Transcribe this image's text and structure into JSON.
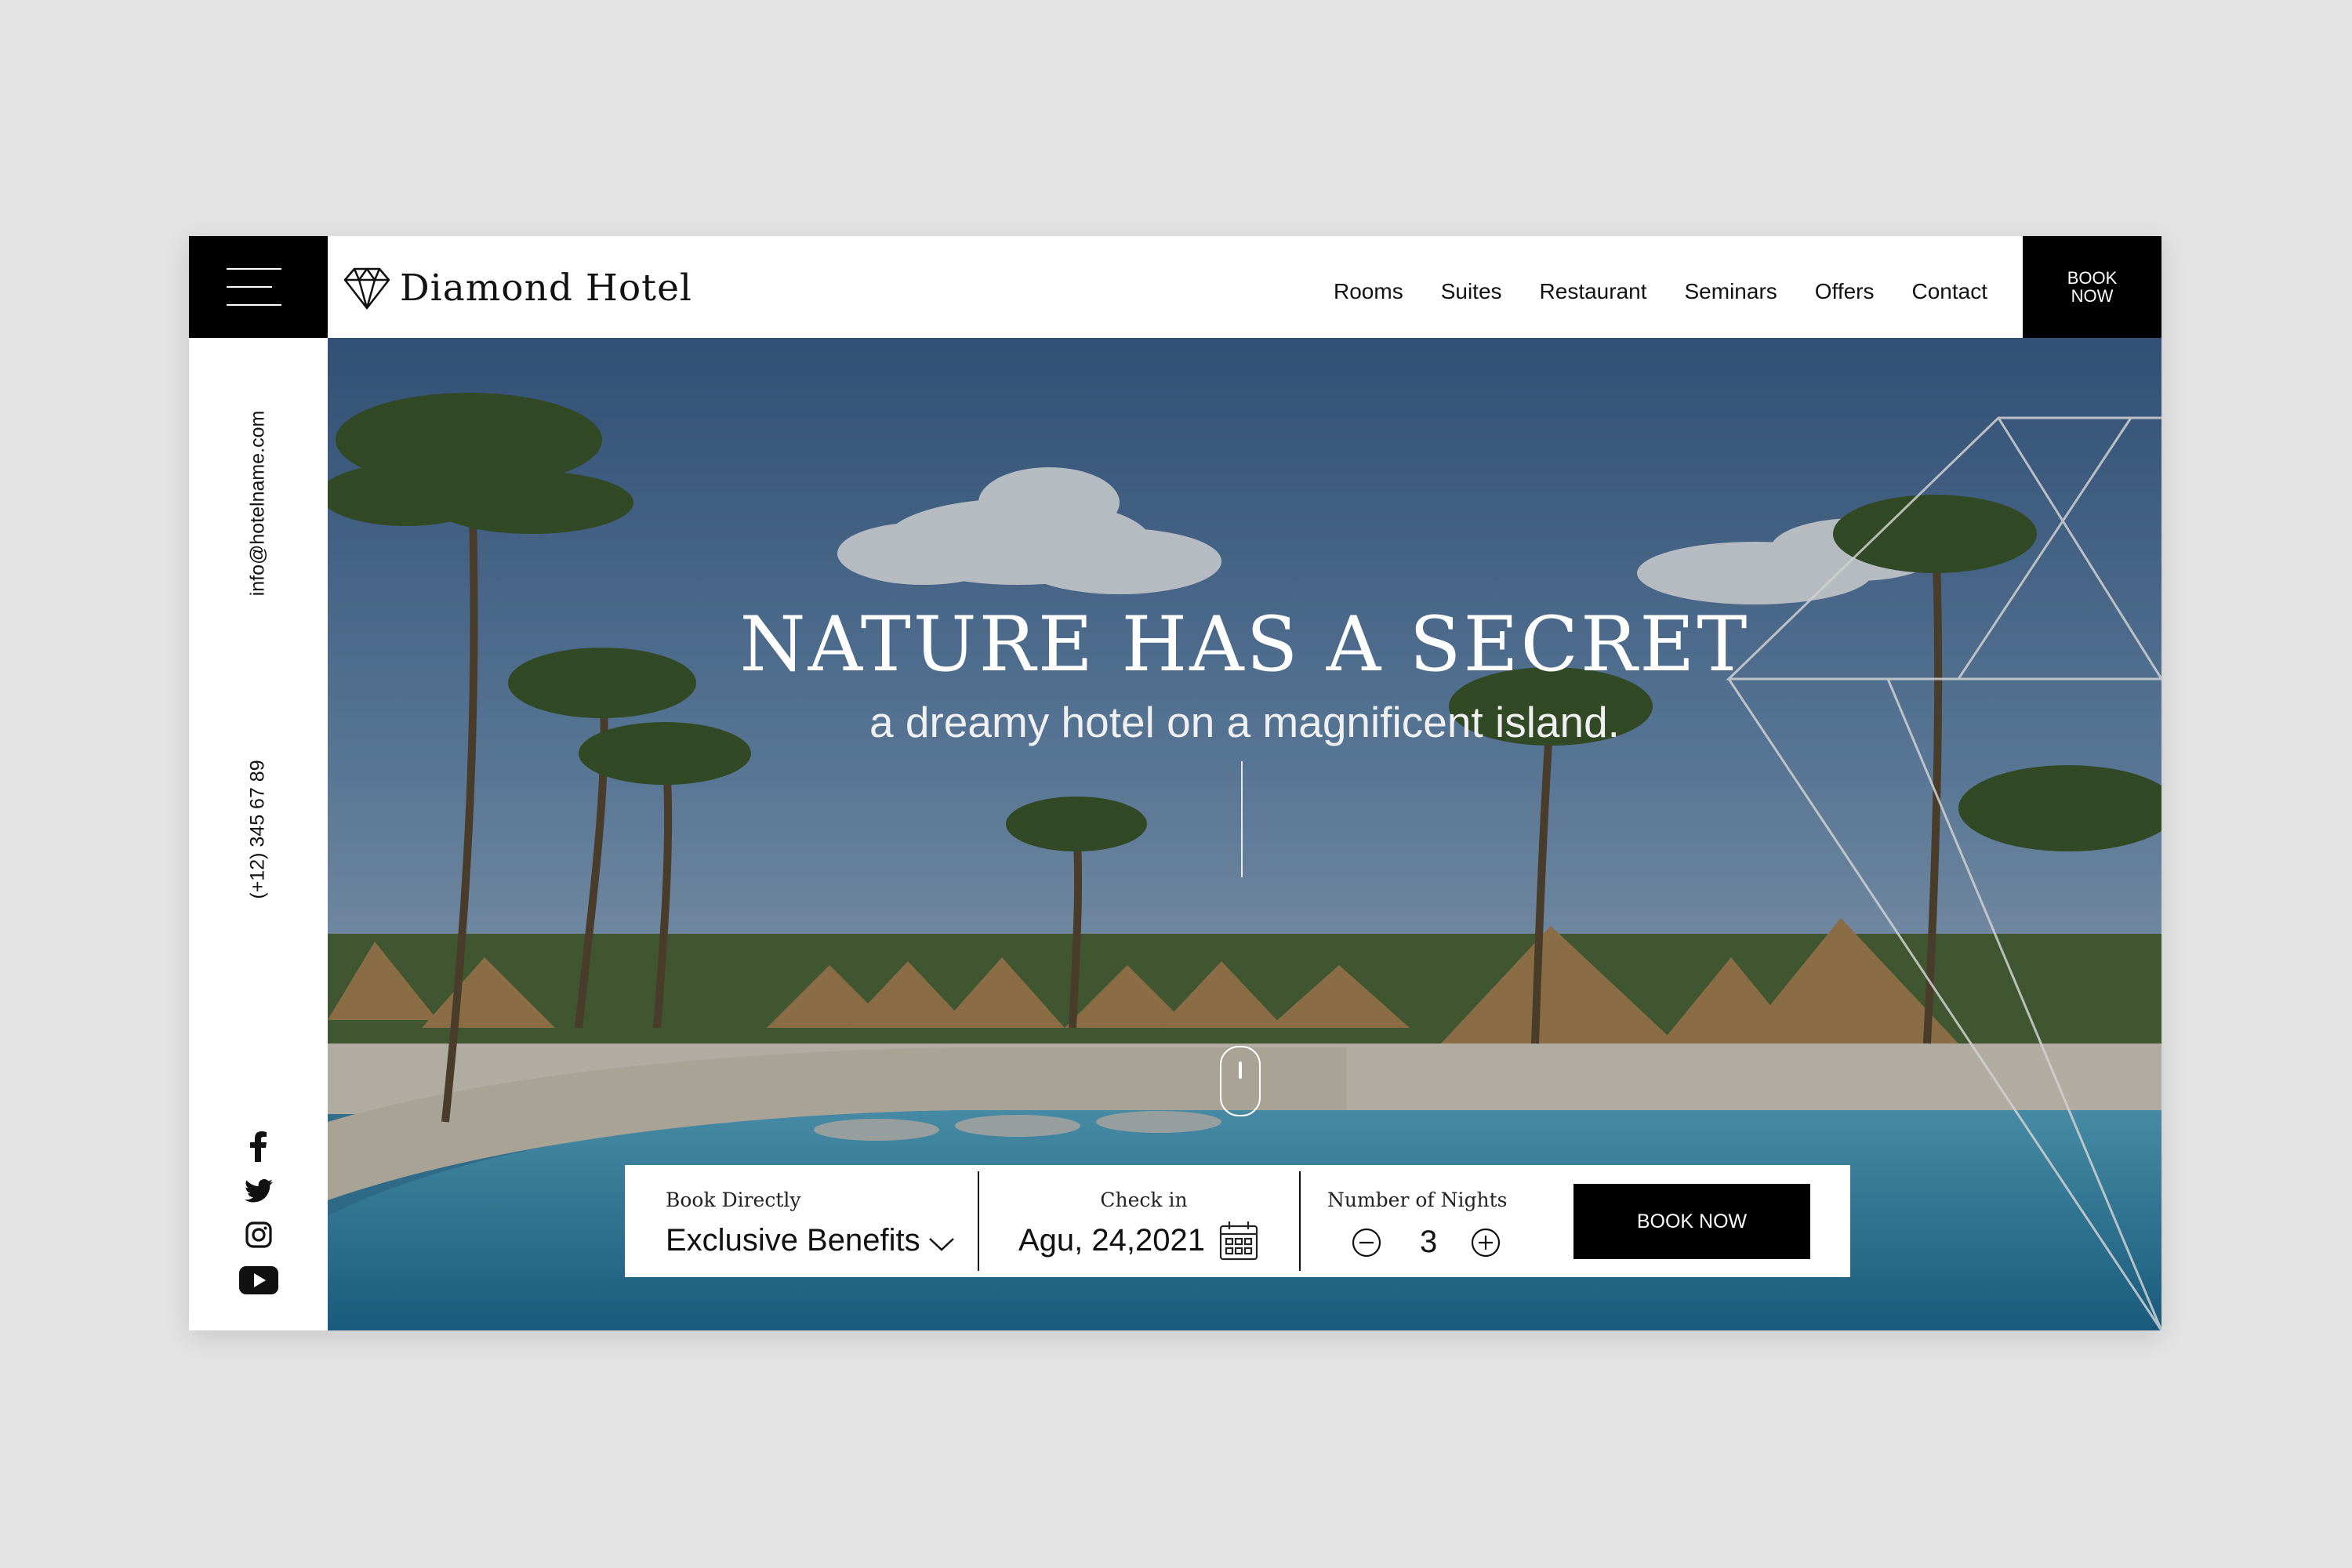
{
  "header": {
    "brand": "Diamond Hotel",
    "nav": [
      "Rooms",
      "Suites",
      "Restaurant",
      "Seminars",
      "Offers",
      "Contact"
    ],
    "book_line1": "BOOK",
    "book_line2": "NOW"
  },
  "sidebar": {
    "email": "info@hotelname.com",
    "phone": "(+12) 345 67 89",
    "social_icons": [
      "facebook-icon",
      "twitter-icon",
      "instagram-icon",
      "youtube-icon"
    ]
  },
  "hero": {
    "title": "NATURE HAS A SECRET",
    "subtitle": "a dreamy hotel on a magnificent island."
  },
  "booking": {
    "book_directly_label": "Book Directly",
    "benefits_value": "Exclusive Benefits",
    "checkin_label": "Check in",
    "checkin_value": "Agu, 24,2021",
    "nights_label": "Number of Nights",
    "nights_value": "3",
    "book_button": "BOOK NOW"
  },
  "colors": {
    "accent": "#000000",
    "background": "#e3e3e3",
    "panel": "#ffffff"
  }
}
